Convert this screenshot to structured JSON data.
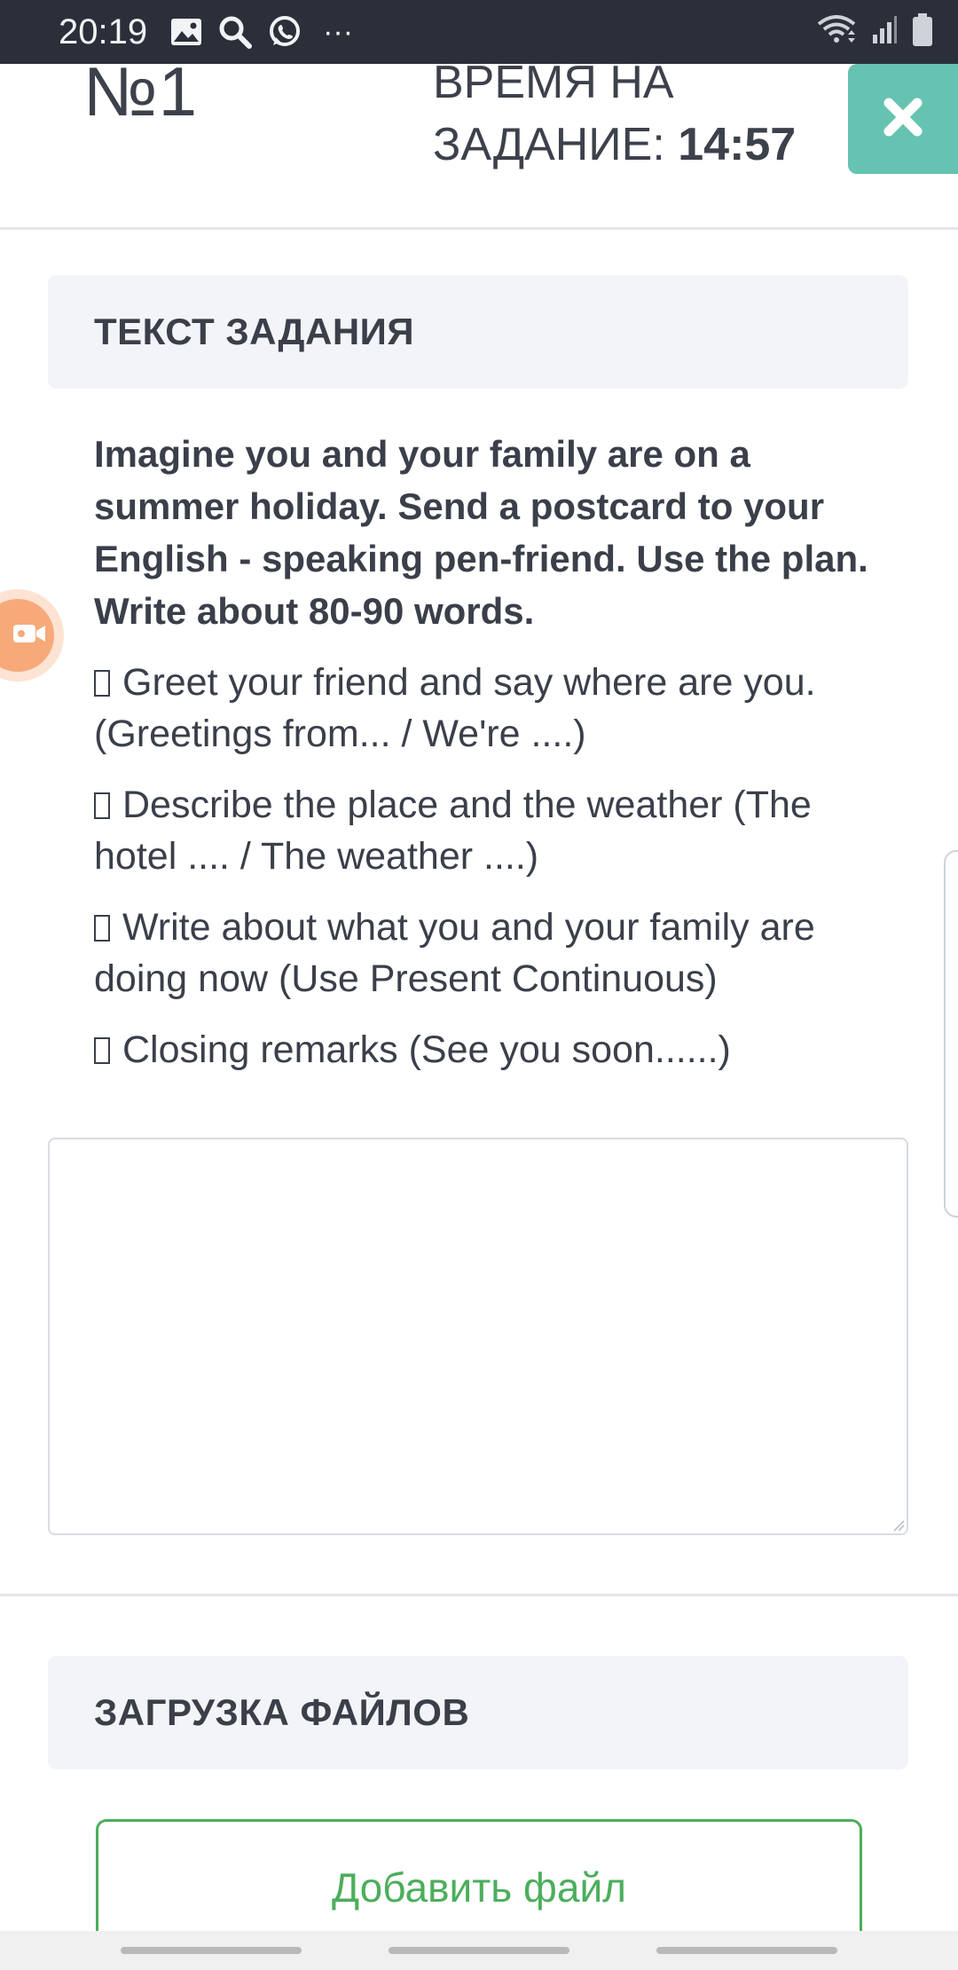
{
  "status_bar": {
    "time": "20:19",
    "icons": [
      "image-icon",
      "search-icon",
      "whatsapp-icon",
      "more-icon"
    ],
    "more_text": "···",
    "right_icons": [
      "wifi-icon",
      "signal-icon",
      "battery-icon"
    ]
  },
  "header": {
    "task_number": "№1",
    "timer_label_line1": "ВРЕМЯ НА",
    "timer_label_line2": "ЗАДАНИЕ:",
    "timer_value": "14:57",
    "close_icon": "close-icon",
    "close_color": "#66c2b1"
  },
  "task_section": {
    "title": "ТЕКСТ ЗАДАНИЯ",
    "instruction": "Imagine you and your family are on a summer holiday. Send a postcard to your English - speaking pen-friend. Use the plan. Write about 80-90 words.",
    "items": [
      "Greet your friend and say where are you. (Greetings from... / We're ....)",
      "Describe the place and the weather (The hotel .... / The weather ....)",
      "Write about what you and your family are doing now (Use Present Continuous)",
      "Closing remarks (See you soon......)"
    ]
  },
  "answer": {
    "value": "",
    "placeholder": ""
  },
  "upload_section": {
    "title": "ЗАГРУЗКА ФАЙЛОВ",
    "add_file_label": "Добавить файл",
    "accent_color": "#4cae5c"
  },
  "floating": {
    "camera_icon": "video-camera-icon",
    "camera_color": "#f7a97a"
  }
}
